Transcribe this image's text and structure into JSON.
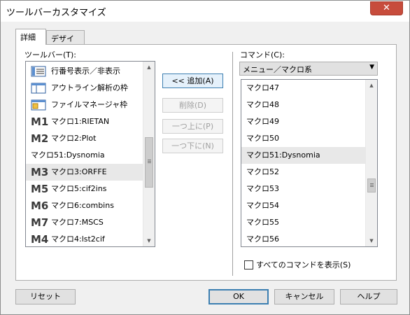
{
  "window": {
    "title": "ツールバーカスタマイズ",
    "close_glyph": "✕"
  },
  "tabs": [
    {
      "label": "詳細"
    },
    {
      "label": "デザイン"
    }
  ],
  "toolbar_list": {
    "label": "ツールバー(T):",
    "items": [
      {
        "label": "行番号表示／非表示",
        "icon": "line-number-icon"
      },
      {
        "label": "アウトライン解析の枠",
        "icon": "outline-pane-icon"
      },
      {
        "label": "ファイルマネージャ枠",
        "icon": "file-manager-icon"
      },
      {
        "label": "マクロ1:RIETAN",
        "icon": "macro-icon",
        "icon_text": "M1"
      },
      {
        "label": "マクロ2:Plot",
        "icon": "macro-icon",
        "icon_text": "M2"
      },
      {
        "label": "マクロ51:Dysnomia",
        "icon": ""
      },
      {
        "label": "マクロ3:ORFFE",
        "icon": "macro-icon",
        "icon_text": "M3"
      },
      {
        "label": "マクロ5:cif2ins",
        "icon": "macro-icon",
        "icon_text": "M5"
      },
      {
        "label": "マクロ6:combins",
        "icon": "macro-icon",
        "icon_text": "M6"
      },
      {
        "label": "マクロ7:MSCS",
        "icon": "macro-icon",
        "icon_text": "M7"
      },
      {
        "label": "マクロ4:lst2cif",
        "icon": "macro-icon",
        "icon_text": "M4"
      }
    ]
  },
  "middle_buttons": {
    "add": "<< 追加(A)",
    "remove": "削除(D)",
    "move_up": "一つ上に(P)",
    "move_down": "一つ下に(N)"
  },
  "command_list": {
    "label": "コマンド(C):",
    "category": "メニュー／マクロ系",
    "items": [
      "マクロ47",
      "マクロ48",
      "マクロ49",
      "マクロ50",
      "マクロ51:Dysnomia",
      "マクロ52",
      "マクロ53",
      "マクロ54",
      "マクロ55",
      "マクロ56"
    ]
  },
  "show_all_commands": {
    "label": "すべてのコマンドを表示(S)",
    "checked": false
  },
  "footer": {
    "reset": "リセット",
    "ok": "OK",
    "cancel": "キャンセル",
    "help": "ヘルプ"
  }
}
